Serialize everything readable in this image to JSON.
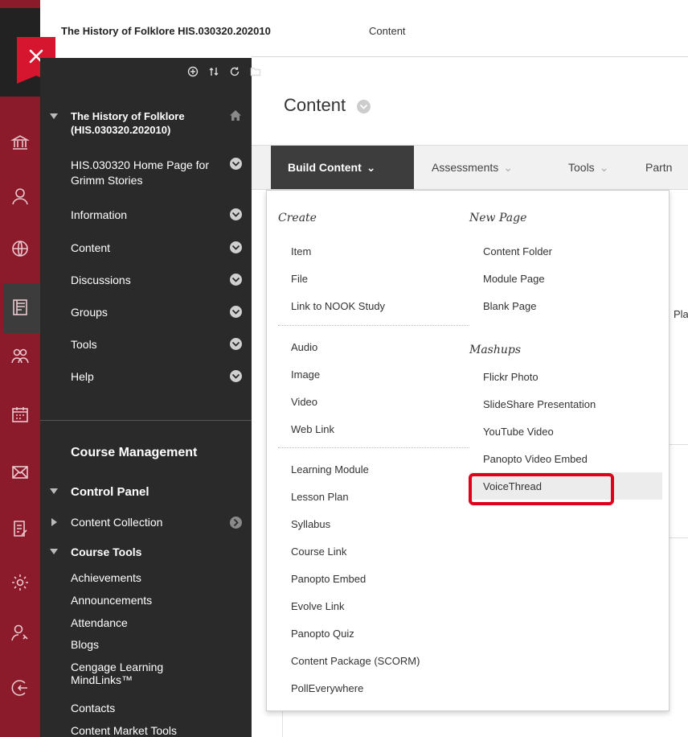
{
  "breadcrumb": {
    "course": "The History of Folklore HIS.030320.202010",
    "page": "Content"
  },
  "rail_icons": [
    "institution-icon",
    "user-icon",
    "globe-icon",
    "courses-icon",
    "groups-icon",
    "calendar-icon",
    "mail-icon",
    "grades-icon",
    "settings-icon",
    "user-key-icon",
    "signout-icon"
  ],
  "course_menu": {
    "title": "The History of Folklore (HIS.030320.202010)",
    "items": [
      {
        "label": "HIS.030320 Home Page for Grimm Stories"
      },
      {
        "label": "Information"
      },
      {
        "label": "Content"
      },
      {
        "label": "Discussions"
      },
      {
        "label": "Groups"
      },
      {
        "label": "Tools"
      },
      {
        "label": "Help"
      }
    ]
  },
  "course_management": {
    "heading": "Course Management",
    "control_panel": "Control Panel",
    "content_collection": "Content Collection",
    "course_tools": "Course Tools",
    "tools": [
      "Achievements",
      "Announcements",
      "Attendance",
      "Blogs",
      "Cengage Learning MindLinks™",
      "Contacts",
      "Content Market Tools"
    ]
  },
  "main": {
    "title": "Content",
    "actions": {
      "build": "Build Content",
      "assessments": "Assessments",
      "tools": "Tools",
      "partner": "Partn"
    },
    "bg_text": "Pla"
  },
  "build_menu": {
    "create_heading": "Create",
    "create_group1": [
      "Item",
      "File",
      "Link to NOOK Study"
    ],
    "create_group2": [
      "Audio",
      "Image",
      "Video",
      "Web Link"
    ],
    "create_group3": [
      "Learning Module",
      "Lesson Plan",
      "Syllabus",
      "Course Link",
      "Panopto Embed",
      "Evolve Link",
      "Panopto Quiz",
      "Content Package (SCORM)",
      "PollEverywhere"
    ],
    "newpage_heading": "New Page",
    "newpage_items": [
      "Content Folder",
      "Module Page",
      "Blank Page"
    ],
    "mashups_heading": "Mashups",
    "mashups_items": [
      "Flickr Photo",
      "SlideShare Presentation",
      "YouTube Video",
      "Panopto Video Embed",
      "VoiceThread"
    ]
  },
  "colors": {
    "rail": "#8b1a2a",
    "menu": "#2a2a2a",
    "close": "#d6152e",
    "highlight": "#e0001b"
  }
}
